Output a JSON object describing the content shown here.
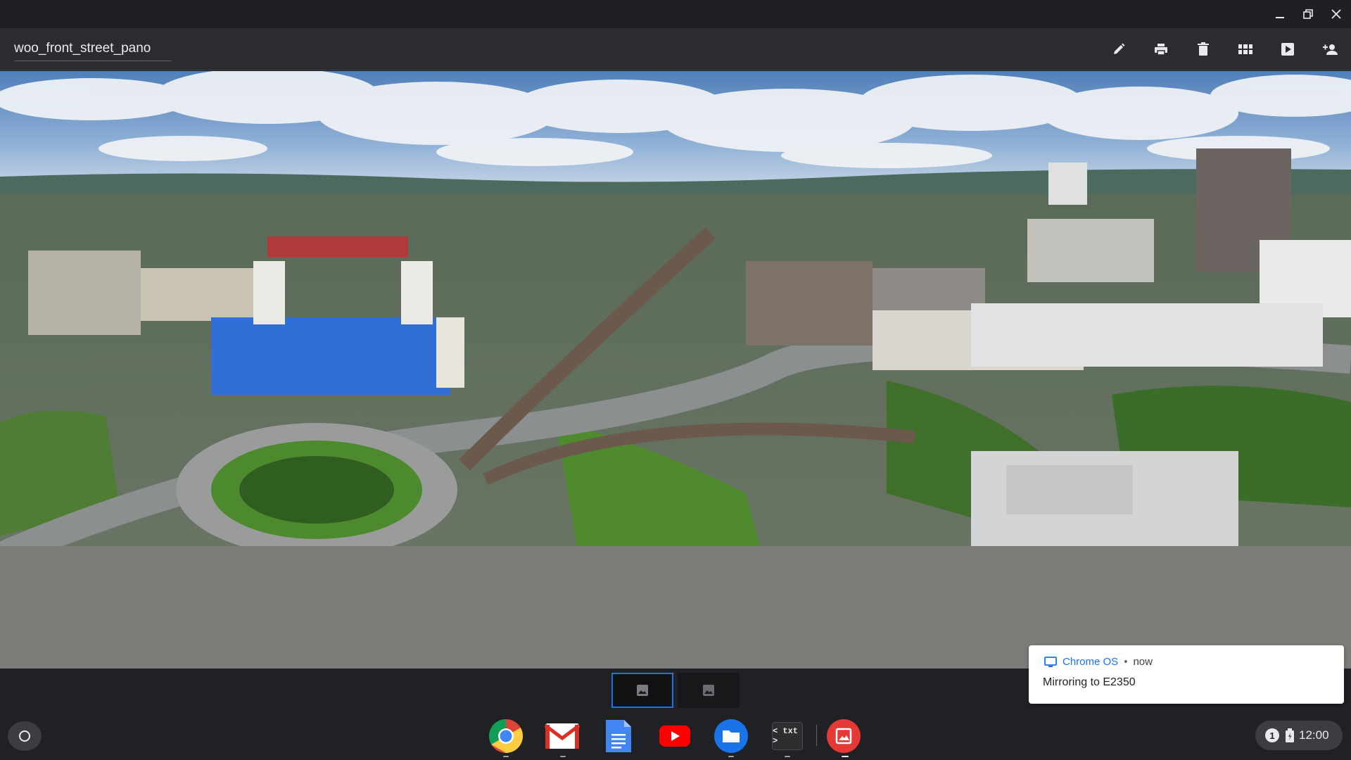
{
  "window": {
    "title": "woo_front_street_pano",
    "controls": [
      "minimize-icon",
      "restore-icon",
      "close-icon"
    ]
  },
  "toolbar": {
    "actions": [
      "edit-icon",
      "print-icon",
      "delete-icon",
      "gallery-icon",
      "slideshow-icon",
      "share-icon"
    ]
  },
  "filmstrip": {
    "thumbnails": [
      {
        "icon": "image-icon",
        "selected": true
      },
      {
        "icon": "image-icon",
        "selected": false
      }
    ]
  },
  "notification": {
    "source": "Chrome OS",
    "separator": "•",
    "time": "now",
    "message": "Mirroring to E2350",
    "icon": "monitor-icon"
  },
  "shelf": {
    "launcher_icon": "launcher-circle-icon",
    "apps": [
      "Chrome",
      "Gmail",
      "Google Docs",
      "YouTube",
      "Files",
      "Text",
      "Gallery"
    ],
    "text_app_label": "< txt >",
    "notification_count": "1",
    "battery_icon": "battery-icon",
    "clock": "12:00"
  },
  "colors": {
    "accent": "#1a73e8",
    "shelf": "#202124",
    "toolbar": "#2b2c30"
  }
}
